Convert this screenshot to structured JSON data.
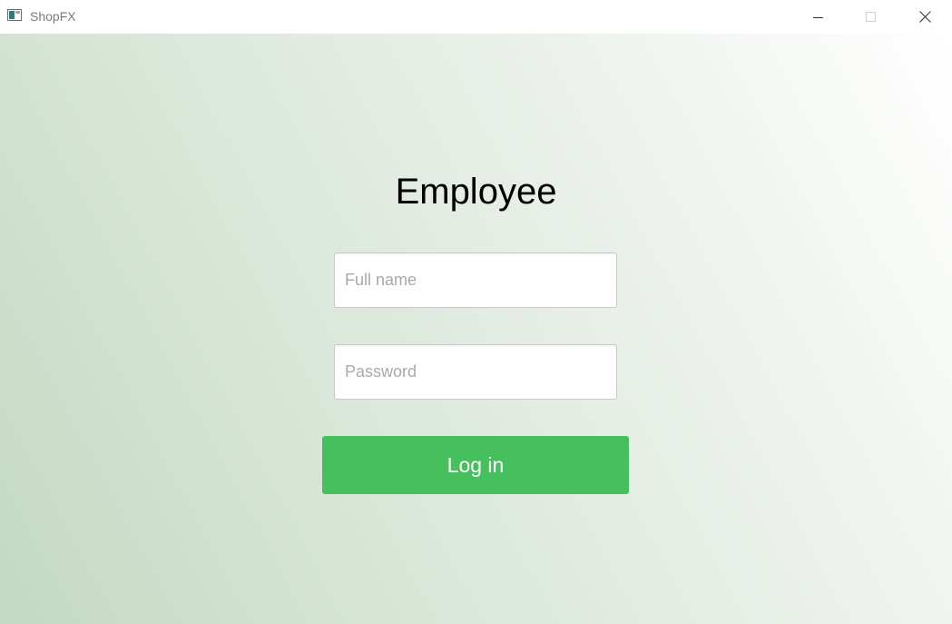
{
  "window": {
    "title": "ShopFX",
    "controls": {
      "minimize": "minimize-icon",
      "maximize": "maximize-icon",
      "close": "close-icon"
    }
  },
  "form": {
    "title": "Employee",
    "full_name": {
      "value": "",
      "placeholder": "Full name"
    },
    "password": {
      "value": "",
      "placeholder": "Password"
    },
    "login_label": "Log in"
  },
  "colors": {
    "accent": "#46c05c",
    "background_from": "#c3d9c2",
    "background_to": "#ffffff"
  }
}
